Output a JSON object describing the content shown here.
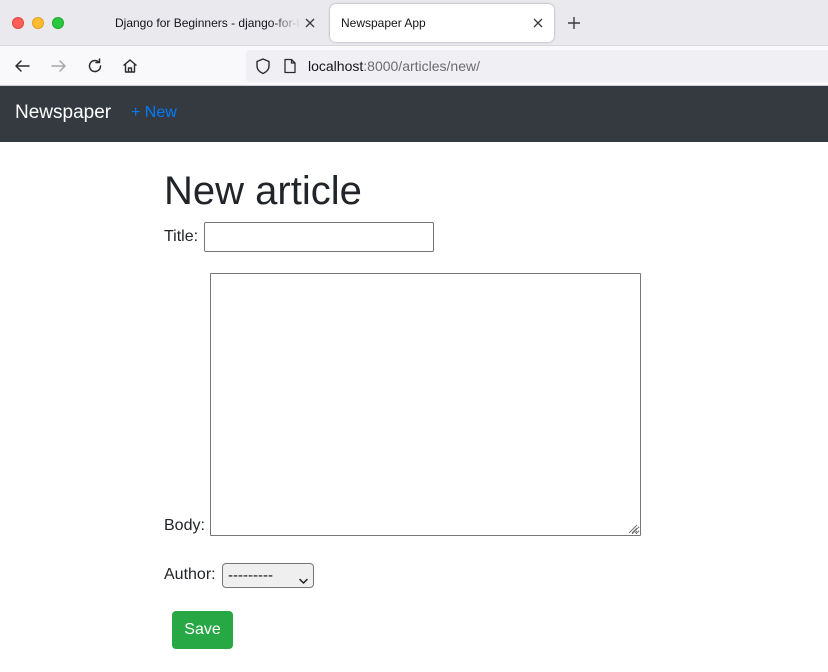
{
  "browser": {
    "tabs": [
      {
        "label": "Django for Beginners - django-for-beginners",
        "active": false
      },
      {
        "label": "Newspaper App",
        "active": true
      }
    ],
    "url_host": "localhost",
    "url_rest": ":8000/articles/new/"
  },
  "site_nav": {
    "brand": "Newspaper",
    "new_link": "+ New"
  },
  "page": {
    "title": "New article",
    "form": {
      "title_label": "Title:",
      "title_value": "",
      "body_label": "Body:",
      "body_value": "",
      "author_label": "Author:",
      "author_selected": "---------",
      "save_label": "Save"
    }
  },
  "colors": {
    "navbar_bg": "#343a40",
    "link": "#007bff",
    "save_button": "#28a745"
  },
  "icons": [
    "back-arrow-icon",
    "forward-arrow-icon",
    "reload-icon",
    "home-icon",
    "shield-icon",
    "page-icon",
    "close-icon",
    "plus-icon",
    "chevron-down-icon"
  ]
}
